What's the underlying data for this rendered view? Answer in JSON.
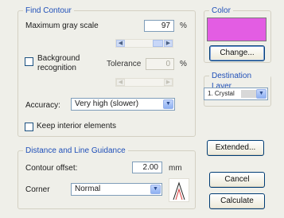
{
  "find_contour": {
    "legend": "Find Contour",
    "max_gray_label": "Maximum gray scale",
    "max_gray_value": "97",
    "max_gray_unit": "%",
    "bg_recognition_label_line1": "Background",
    "bg_recognition_label_line2": "recognition",
    "bg_recognition_checked": false,
    "tolerance_label": "Tolerance",
    "tolerance_value": "0",
    "tolerance_unit": "%",
    "accuracy_label": "Accuracy:",
    "accuracy_value": "Very high (slower)",
    "keep_interior_label": "Keep interior elements",
    "keep_interior_checked": false
  },
  "color": {
    "legend": "Color",
    "swatch_color": "#e35de3",
    "change_label": "Change..."
  },
  "destination": {
    "legend": "Destination Layer",
    "value": "1. Crystal"
  },
  "distance": {
    "legend": "Distance and Line Guidance",
    "offset_label": "Contour offset:",
    "offset_value": "2.00",
    "offset_unit": "mm",
    "corner_label": "Corner",
    "corner_value": "Normal"
  },
  "buttons": {
    "extended": "Extended...",
    "cancel": "Cancel",
    "calculate": "Calculate"
  }
}
